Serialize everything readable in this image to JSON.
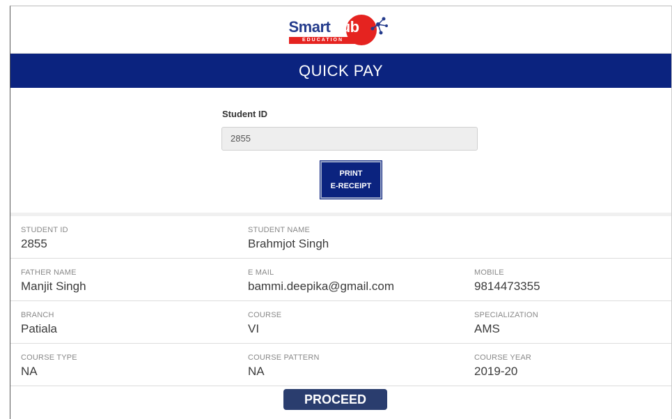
{
  "logo": {
    "word_smart": "Smart",
    "word_hub": "Hub",
    "subtitle": "EDUCATION"
  },
  "header": {
    "title": "QUICK PAY"
  },
  "form": {
    "student_id_label": "Student ID",
    "student_id_value": "2855",
    "print_button_line1": "PRINT",
    "print_button_line2": "E-RECEIPT"
  },
  "details": {
    "rows": [
      [
        {
          "label": "STUDENT ID",
          "value": "2855"
        },
        {
          "label": "STUDENT NAME",
          "value": "Brahmjot Singh"
        }
      ],
      [
        {
          "label": "FATHER NAME",
          "value": "Manjit Singh"
        },
        {
          "label": "E MAIL",
          "value": "bammi.deepika@gmail.com"
        },
        {
          "label": "MOBILE",
          "value": "9814473355"
        }
      ],
      [
        {
          "label": "BRANCH",
          "value": "Patiala"
        },
        {
          "label": "COURSE",
          "value": "VI"
        },
        {
          "label": "SPECIALIZATION",
          "value": "AMS"
        }
      ],
      [
        {
          "label": "COURSE TYPE",
          "value": "NA"
        },
        {
          "label": "COURSE PATTERN",
          "value": "NA"
        },
        {
          "label": "COURSE YEAR",
          "value": "2019-20"
        }
      ]
    ]
  },
  "footer": {
    "proceed_label": "PROCEED"
  },
  "colors": {
    "brand_navy": "#0b237f",
    "brand_red": "#e52320",
    "proceed": "#2a3d6e"
  }
}
